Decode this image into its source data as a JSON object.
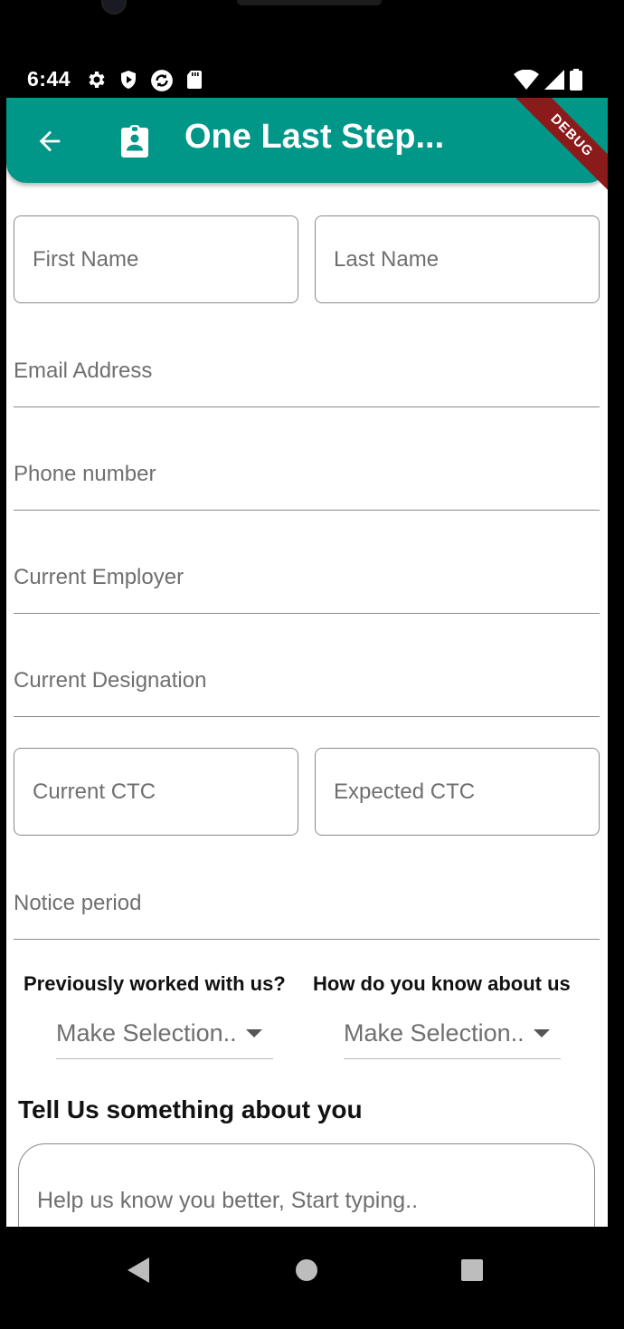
{
  "status_bar": {
    "time": "6:44",
    "icons_left": [
      "gear-icon",
      "play-shield-icon",
      "sync-icon",
      "sd-card-icon"
    ],
    "icons_right": [
      "wifi-icon",
      "signal-icon",
      "battery-icon"
    ]
  },
  "app_bar": {
    "title": "One Last Step...",
    "back_icon": "arrow-left-icon",
    "title_icon": "badge-account-icon",
    "debug_label": "DEBUG",
    "color": "#009688"
  },
  "form": {
    "first_name": {
      "placeholder": "First Name",
      "value": ""
    },
    "last_name": {
      "placeholder": "Last Name",
      "value": ""
    },
    "email": {
      "placeholder": "Email Address",
      "value": ""
    },
    "phone": {
      "placeholder": "Phone number",
      "value": ""
    },
    "employer": {
      "placeholder": "Current Employer",
      "value": ""
    },
    "designation": {
      "placeholder": "Current Designation",
      "value": ""
    },
    "current_ctc": {
      "placeholder": "Current CTC",
      "value": ""
    },
    "expected_ctc": {
      "placeholder": "Expected CTC",
      "value": ""
    },
    "notice_period": {
      "placeholder": "Notice period",
      "value": ""
    },
    "previously_worked": {
      "label": "Previously worked with us?",
      "selected": "Make Selection.."
    },
    "how_know": {
      "label": "How do you know about us",
      "selected": "Make Selection.."
    },
    "about": {
      "heading": "Tell Us something about you",
      "placeholder": "Help us know you better, Start typing.."
    }
  },
  "nav_bar": {
    "icons": [
      "back-triangle-icon",
      "home-circle-icon",
      "recents-square-icon"
    ]
  }
}
